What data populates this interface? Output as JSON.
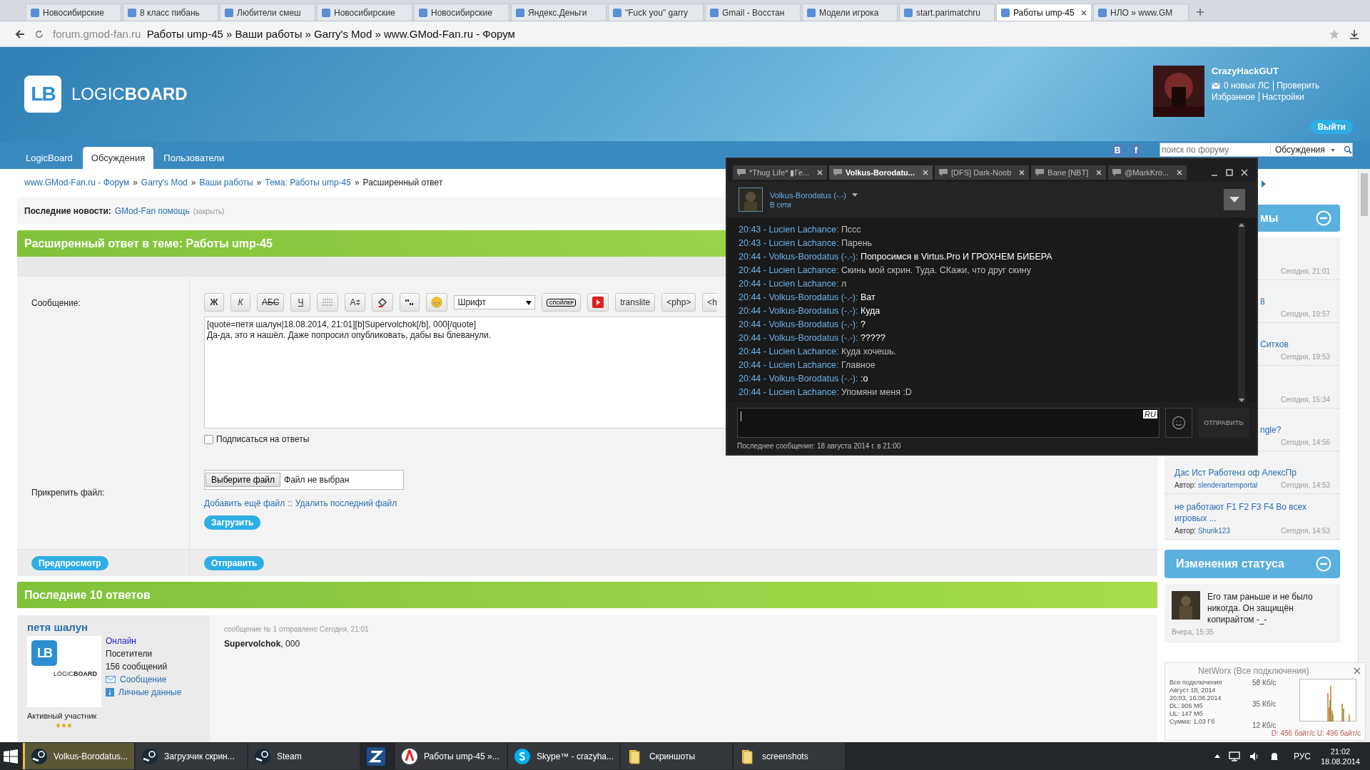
{
  "browser": {
    "tabs": [
      {
        "title": "Новосибирские",
        "selected": false
      },
      {
        "title": "8 класс пибань",
        "selected": false
      },
      {
        "title": "Любители смеш",
        "selected": false
      },
      {
        "title": "Новосибирские",
        "selected": false
      },
      {
        "title": "Новосибирские",
        "selected": false
      },
      {
        "title": "Яндекс.Деньги",
        "selected": false
      },
      {
        "title": "\"Fuck you\" garry",
        "selected": false
      },
      {
        "title": "Gmail - Восстан",
        "selected": false
      },
      {
        "title": "Модели игрока",
        "selected": false
      },
      {
        "title": "start.parimatchru",
        "selected": false
      },
      {
        "title": "Работы ump-45",
        "selected": true
      },
      {
        "title": "НЛО » www.GM",
        "selected": false
      }
    ],
    "address": {
      "domain": "forum.gmod-fan.ru",
      "title": "Работы ump-45 » Ваши работы » Garry's Mod » www.GMod-Fan.ru - Форум"
    }
  },
  "header": {
    "logo": {
      "mark": "LB",
      "name": "LOGIC**BOARD**"
    },
    "user": {
      "name": "CrazyHackGUT",
      "messages": "0 новых ЛС",
      "check": "Проверить",
      "favorites": "Избранное",
      "settings": "Настройки",
      "logout": "Выйти"
    }
  },
  "nav": {
    "tabs": [
      {
        "label": "LogicBoard",
        "selected": false
      },
      {
        "label": "Обсуждения",
        "selected": true
      },
      {
        "label": "Пользователи",
        "selected": false
      }
    ],
    "social": [
      "В",
      "f"
    ],
    "search": {
      "placeholder": "поиск по форуму",
      "scope": "Обсуждения"
    }
  },
  "breadcrumbs": {
    "separator": "»",
    "items": [
      {
        "label": "www.GMod-Fan.ru - Форум",
        "link": true
      },
      {
        "label": "Garry's Mod",
        "link": true
      },
      {
        "label": "Ваши работы",
        "link": true
      },
      {
        "label": "Тема: Работы ump-45",
        "link": true
      },
      {
        "label": "Расширенный ответ",
        "link": false
      }
    ]
  },
  "news": {
    "label": "Последние новости:",
    "link": "GMod-Fan помощь",
    "close": "(закрыть)"
  },
  "reply": {
    "title": "Расширенный ответ в теме: Работы ump-45",
    "message_label": "Сообщение:",
    "toolbar": [
      {
        "kind": "format",
        "label": "Ж"
      },
      {
        "kind": "format",
        "label": "К"
      },
      {
        "kind": "format",
        "label": "АБС"
      },
      {
        "kind": "format",
        "label": "Ч"
      },
      {
        "kind": "lines"
      },
      {
        "kind": "size",
        "label": "A"
      },
      {
        "kind": "paint"
      },
      {
        "kind": "quote"
      },
      {
        "kind": "smile"
      },
      {
        "kind": "select",
        "label": "Шрифт"
      },
      {
        "kind": "spoiler",
        "label": "СПОЙЛЕР"
      },
      {
        "kind": "youtube"
      },
      {
        "kind": "format",
        "label": "translite"
      },
      {
        "kind": "format",
        "label": "<php>"
      },
      {
        "kind": "format",
        "label": "<h"
      }
    ],
    "text": [
      "[quote=петя шалун|18.08.2014, 21:01][b]Supervolchok[/b], 000[/quote]",
      "Да-да, это я нашёл. Даже попросил опубликовать, дабы вы блеванули."
    ],
    "subscribe": {
      "label": "Подписаться на ответы",
      "checked": false
    },
    "attach_label": "Прикрепить файл:",
    "choose": "Выберите файл",
    "no_file": "Файл не выбран",
    "attach_links": [
      "Добавить ещё файл",
      "::",
      "Удалить последний файл"
    ],
    "upload": "Загрузить",
    "preview": "Предпросмотр",
    "send": "Отправить"
  },
  "replies": {
    "title": "Последние 10 ответов",
    "post": {
      "author": "петя шалун",
      "online": "Онлайн",
      "group": "Посетители",
      "count": "156 сообщений",
      "message_link": "Сообщение",
      "profile_link": "Личные данные",
      "rank": "Активный участник",
      "stars": 3,
      "avatar": {
        "mark": "LB",
        "name": "LOGIC**BOARD**"
      },
      "meta": "сообщение № 1 отправлено Сегодня, 21:01",
      "body": "**Supervolchok**, 000"
    }
  },
  "sidebar": {
    "topics": {
      "title": "мы",
      "items": [
        {
          "date": "Сегодня, 21:01"
        },
        {
          "title": "8",
          "date": "Сегодня, 19:57"
        },
        {
          "title": "Ситхов",
          "date": "Сегодня, 19:53"
        },
        {
          "date": "Сегодня, 15:34"
        },
        {
          "title": "ngle?",
          "date": "Сегодня, 14:56"
        },
        {
          "title": "Дас Ист Работенз оф АлексПр",
          "author_label": "Автор:",
          "author": "slenderartemportal",
          "date": "Сегодня, 14:53"
        },
        {
          "title": "не работают F1 F2 F3 F4 Во всех игровых ...",
          "author_label": "Автор:",
          "author": "Shurik123",
          "date": "Сегодня, 14:53"
        }
      ]
    },
    "status": {
      "title": "Изменения статуса",
      "items": [
        {
          "text": "Его там раньше и не было никогда. Он защищён копирайтом -_-",
          "date": "Вчера, 15:35"
        }
      ]
    }
  },
  "chat": {
    "tabs": [
      {
        "label": "*Thug Life* ▮Ге...",
        "selected": false
      },
      {
        "label": "Volkus-Borodatu...",
        "selected": true
      },
      {
        "label": "[DFS] Dark-Noob",
        "selected": false
      },
      {
        "label": "Bane [NBT]",
        "selected": false
      },
      {
        "label": "@MarkKro...",
        "selected": false
      }
    ],
    "friend": {
      "name": "Volkus-Borodatus (-.-)",
      "status": "В сети"
    },
    "messages": [
      {
        "sender": "20:43 - Lucien Lachance:",
        "text": "Пссс",
        "from_friend": false
      },
      {
        "sender": "20:43 - Lucien Lachance:",
        "text": "Парень",
        "from_friend": false
      },
      {
        "sender": "20:44 - Volkus-Borodatus (-.-):",
        "text": "Попросимся в Virtus.Pro И ГРОХНЕМ БИБЕРА",
        "from_friend": true
      },
      {
        "sender": "20:44 - Lucien Lachance:",
        "text": "Скинь мой скрин. Туда. СКажи, что друг скину",
        "from_friend": false
      },
      {
        "sender": "20:44 - Lucien Lachance:",
        "text": "л",
        "from_friend": false
      },
      {
        "sender": "20:44 - Volkus-Borodatus (-.-):",
        "text": "Ват",
        "from_friend": true
      },
      {
        "sender": "20:44 - Volkus-Borodatus (-.-):",
        "text": "Куда",
        "from_friend": true
      },
      {
        "sender": "20:44 - Volkus-Borodatus (-.-):",
        "text": "?",
        "from_friend": true
      },
      {
        "sender": "20:44 - Volkus-Borodatus (-.-):",
        "text": "?????",
        "from_friend": true
      },
      {
        "sender": "20:44 - Lucien Lachance:",
        "text": "Куда хочешь.",
        "from_friend": false
      },
      {
        "sender": "20:44 - Lucien Lachance:",
        "text": "Главное",
        "from_friend": false
      },
      {
        "sender": "20:44 - Volkus-Borodatus (-.-):",
        "text": ":o",
        "from_friend": true
      },
      {
        "sender": "20:44 - Lucien Lachance:",
        "text": "Упомяни меня :D",
        "from_friend": false
      }
    ],
    "language": "RU",
    "send": "ОТПРАВИТЬ",
    "footer": "Последнее сообщение: 18 августа 2014 г. в 21:00"
  },
  "networx": {
    "title": "NetWorx (Все подключения)",
    "stats": [
      "Все подключения",
      "Август 18, 2014",
      "20:03, 16.08.2014",
      "DL: 906 Мб",
      "UL: 147 Мб",
      "Сумма: 1,03 Гб"
    ],
    "scale": [
      "58 Кб/с",
      "35 Кб/с",
      "12 Кб/с"
    ],
    "rates": "D: 456 байт/с U: 496 байт/с"
  },
  "taskbar": {
    "items": [
      {
        "label": "Volkus-Borodatus...",
        "kind": "steam",
        "selected": true
      },
      {
        "label": "Загрузчик скрин...",
        "kind": "steam",
        "selected": false
      },
      {
        "label": "Steam",
        "kind": "steam",
        "selected": false
      },
      {
        "kind": "zapp",
        "selected": false
      },
      {
        "label": "Работы ump-45 »...",
        "kind": "yandex",
        "selected": false
      },
      {
        "label": "Skype™ - crazyha...",
        "kind": "skype",
        "selected": false
      },
      {
        "label": "Скриншоты",
        "kind": "folder",
        "selected": false
      },
      {
        "label": "screenshots",
        "kind": "folder",
        "selected": false
      }
    ],
    "language": "РУС",
    "time": "21:02",
    "date": "18.08.2014"
  }
}
